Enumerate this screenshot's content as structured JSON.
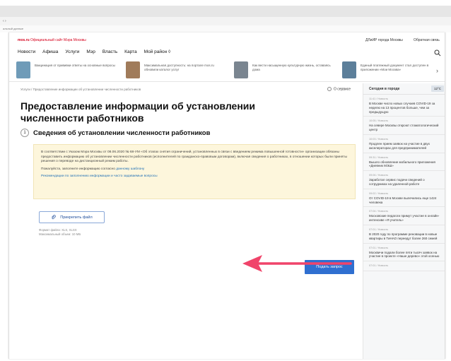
{
  "browser": {
    "back_glyph": "‹ ›",
    "frame_label": "альный данные"
  },
  "site": {
    "logo": "mos.ru",
    "tagline": "Официальный сайт Мэра Москвы",
    "top_links": [
      "ДЛиИР города Москвы",
      "Обратная связь"
    ],
    "nav": [
      "Новости",
      "Афиша",
      "Услуги",
      "Мэр",
      "Власть",
      "Карта",
      "Мой район ◊"
    ]
  },
  "news_strip": [
    {
      "text": "Вакцинация от прививки ответы на основные вопросы",
      "thumb_color": "#6f9bb8"
    },
    {
      "text": "Максимальная доступность: на портале mos.ru обновили каталог услуг",
      "thumb_color": "#a07b5a"
    },
    {
      "text": "Как вести насыщенную культурную жизнь, оставаясь дома",
      "thumb_color": "#7a8590"
    },
    {
      "text": "Единый платежный документ стал доступен в приложении «Мои Москва»",
      "thumb_color": "#5c7f9a"
    }
  ],
  "main": {
    "breadcrumb": "Услуги  /  Предоставление информации об установлении численности работников",
    "back_label": "О сервисе",
    "title": "Предоставление информации об установлении численности работников",
    "step_number": "1",
    "step_title": "Сведения об установлении численности работников",
    "notice": {
      "paragraph": "В соответствии с Указом Мэра Москвы от 08.06.2020 № 68-УМ «Об этапах снятия ограничений, установленных в связи с введением режима повышенной готовности» организации обязаны предоставить информацию об установлении численности работников (исполнителей по гражданско-правовым договорам), включая сведения о работниках, в отношении которых были приняты решения о переводе на дистанционный режим работы.",
      "fill_prefix": "Пожалуйста, заполните информацию согласно ",
      "fill_link": "данному шаблону",
      "recommendations_link": "Рекомендации по заполнению информации и часто задаваемые вопросы"
    },
    "upload_label": "Прикрепить файл",
    "file_format": "Формат файла: XLS, XLSX",
    "file_size": "Максимальный объем: 10 МБ",
    "submit_label": "Подать запрос"
  },
  "sidebar": {
    "title": "Сегодня в городе",
    "temperature": "12°C",
    "items": [
      {
        "time": "11:41 / Новость",
        "text": "В Москве число новых случаев COVID-19 за неделю на 13 процентов больше, чем за предыдущую"
      },
      {
        "time": "10:05 / Новость",
        "text": "На севере Москвы откроют стоматологический центр"
      },
      {
        "time": "10:03 / Новость",
        "text": "Продлен прием заявок на участие в двух акселераторах для предпринимателей"
      },
      {
        "time": "09:31 / Новость",
        "text": "Вышло обновление мобильного приложения «Дневник МЭШ»"
      },
      {
        "time": "09:06 / Новость",
        "text": "Заработал сервис подачи сведений о сотрудниках на удаленной работе"
      },
      {
        "time": "09:02 / Новость",
        "text": "От COVID-19 в Москве вылечилиcь еще 1424 человека"
      },
      {
        "time": "07:04 / Новость",
        "text": "Московские педагоги примут участие в онлайн-интенсиве «Я учитель»"
      },
      {
        "time": "07:01 / Новость",
        "text": "В 2020 году по программе реновации в новые квартиры в ТиНАО переедут более 260 семей"
      },
      {
        "time": "07:01 / Новость",
        "text": "Москвичи подали более пяти тысяч заявок на участие в проекте «Наше дерево» этой осенью"
      },
      {
        "time": "07:01 / Новость",
        "text": ""
      }
    ]
  },
  "colors": {
    "accent_red": "#d6001c",
    "link_blue": "#1f6fb5",
    "button_blue": "#2f6fd0",
    "notice_bg": "#fdf6dc",
    "arrow_pink": "#f0446a"
  },
  "icons": {
    "search": "search-icon",
    "paperclip": "paperclip-icon",
    "chevron": "chevron-right-icon",
    "annotation": "annotation-arrow"
  }
}
